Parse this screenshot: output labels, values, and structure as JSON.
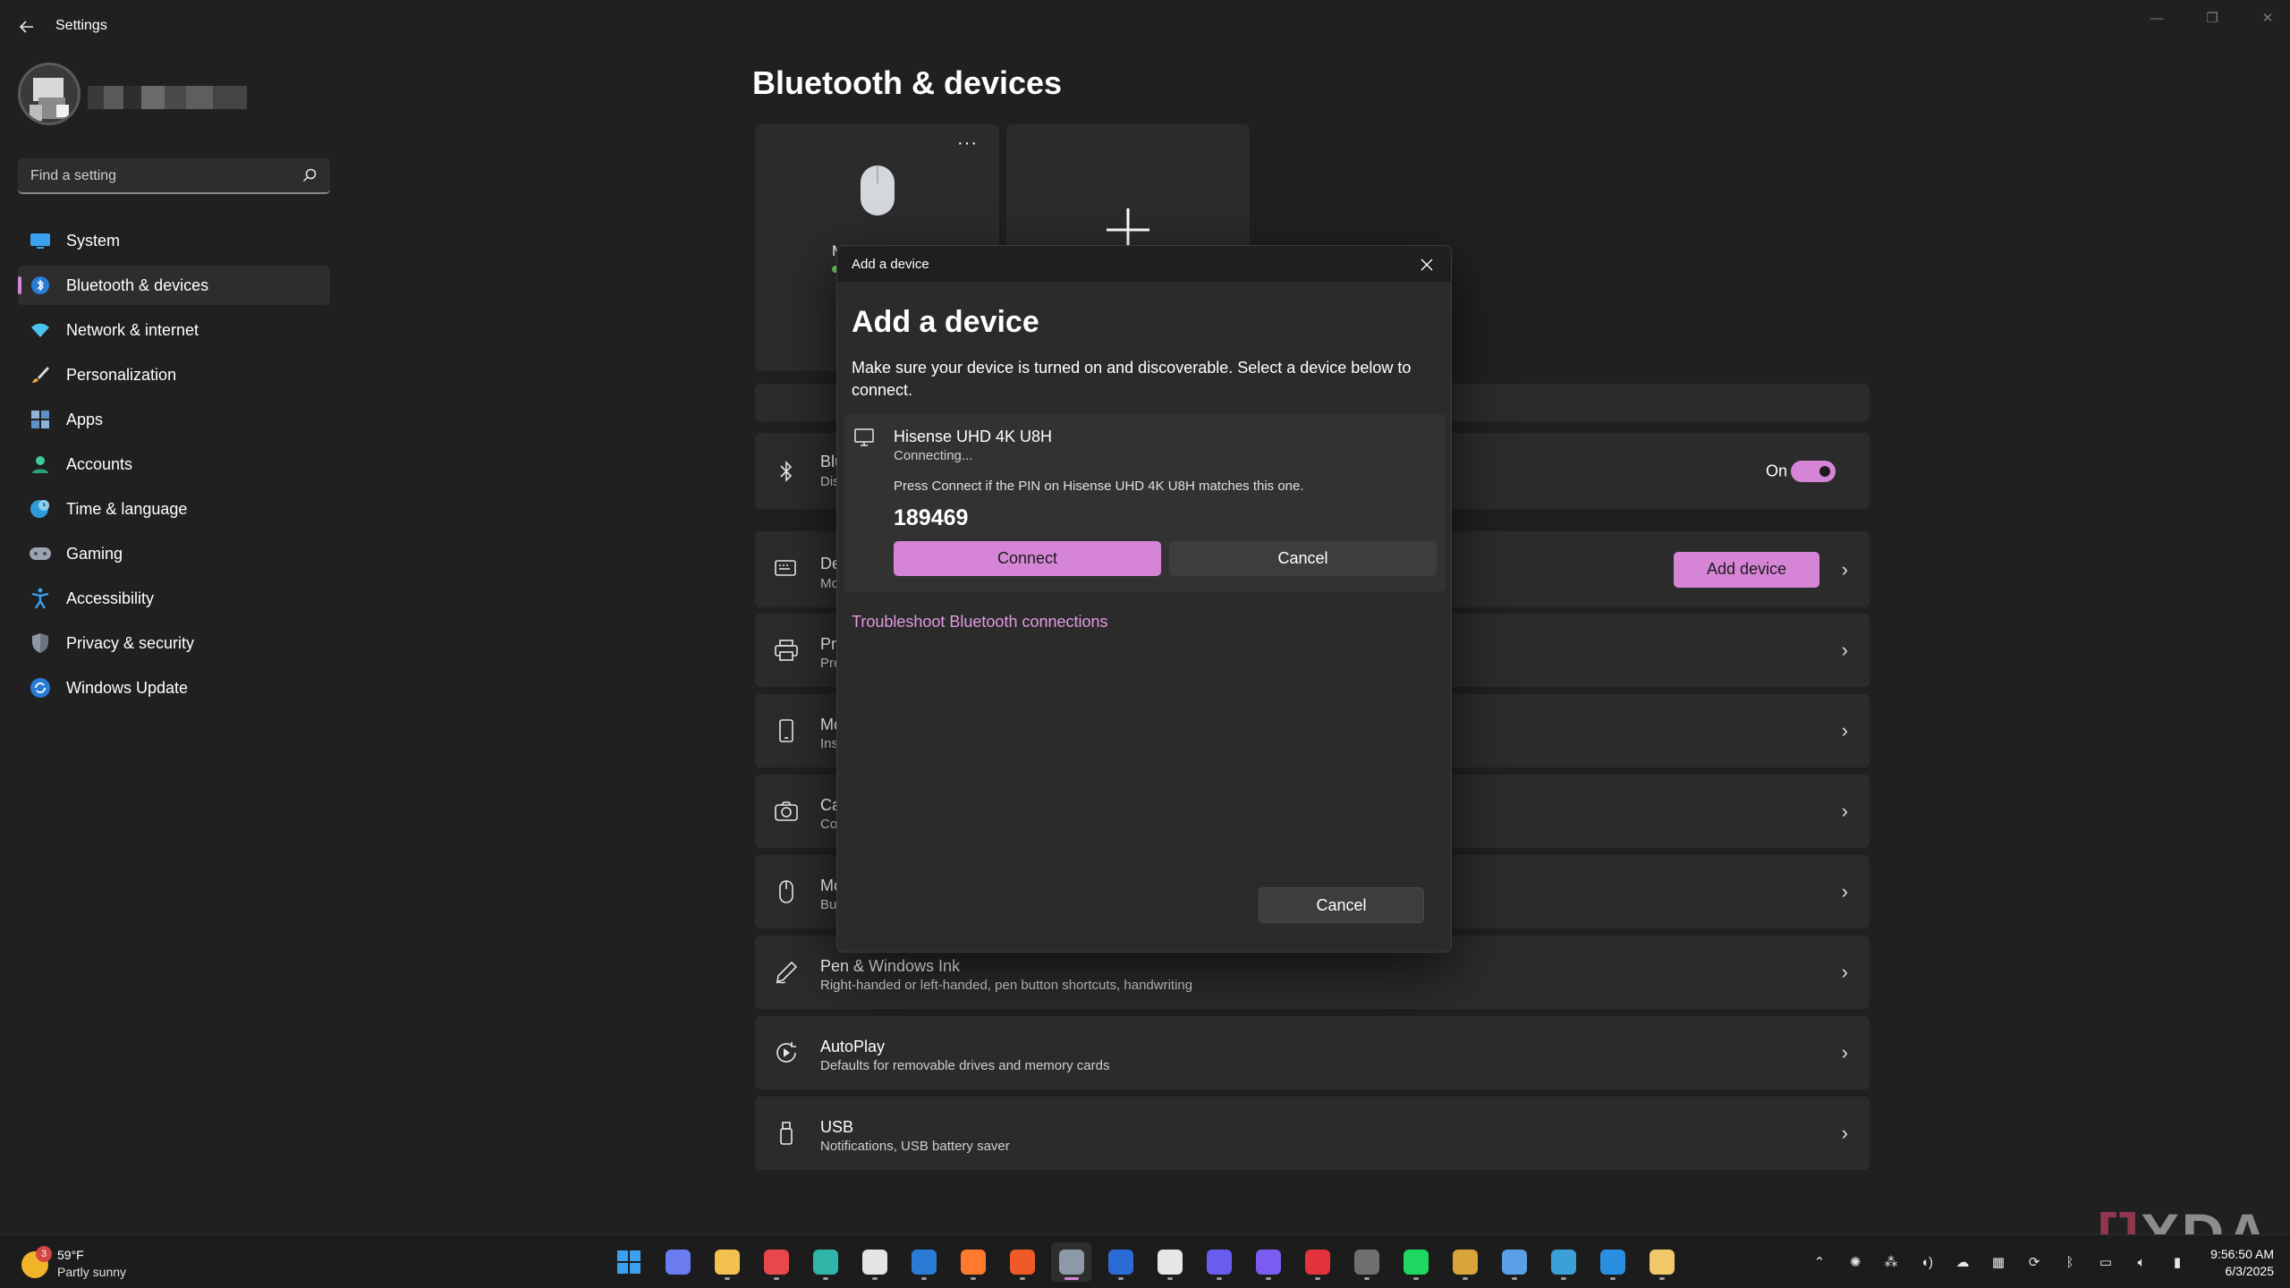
{
  "window": {
    "title": "Settings"
  },
  "colors": {
    "accent": "#d685d6",
    "link": "#e29ae2",
    "background": "#202020",
    "card": "#2b2b2b"
  },
  "sidebar": {
    "search_placeholder": "Find a setting",
    "items": [
      {
        "label": "System",
        "icon": "system-icon",
        "active": false
      },
      {
        "label": "Bluetooth & devices",
        "icon": "bluetooth-icon",
        "active": true
      },
      {
        "label": "Network & internet",
        "icon": "wifi-icon",
        "active": false
      },
      {
        "label": "Personalization",
        "icon": "brush-icon",
        "active": false
      },
      {
        "label": "Apps",
        "icon": "apps-icon",
        "active": false
      },
      {
        "label": "Accounts",
        "icon": "person-icon",
        "active": false
      },
      {
        "label": "Time & language",
        "icon": "globe-clock-icon",
        "active": false
      },
      {
        "label": "Gaming",
        "icon": "gamepad-icon",
        "active": false
      },
      {
        "label": "Accessibility",
        "icon": "accessibility-icon",
        "active": false
      },
      {
        "label": "Privacy & security",
        "icon": "shield-icon",
        "active": false
      },
      {
        "label": "Windows Update",
        "icon": "update-icon",
        "active": false
      }
    ]
  },
  "main": {
    "title": "Bluetooth & devices",
    "device_card": {
      "name_partial": "M",
      "more_label": "···"
    },
    "rows": [
      {
        "title": "Blu",
        "subtitle": "Dis",
        "icon": "bluetooth-icon",
        "toggle_label": "On"
      },
      {
        "title": "De",
        "subtitle": "Mo",
        "icon": "devices-icon",
        "button": "Add device"
      },
      {
        "title": "Pri",
        "subtitle": "Pre",
        "icon": "printer-icon"
      },
      {
        "title": "Mo",
        "subtitle": "Ins",
        "icon": "phone-icon"
      },
      {
        "title": "Ca",
        "subtitle": "Co",
        "icon": "camera-icon"
      },
      {
        "title": "Mo",
        "subtitle": "Bu",
        "icon": "mouse-icon"
      },
      {
        "title": "Pen & Windows Ink",
        "subtitle": "Right-handed or left-handed, pen button shortcuts, handwriting",
        "icon": "pen-icon"
      },
      {
        "title": "AutoPlay",
        "subtitle": "Defaults for removable drives and memory cards",
        "icon": "autoplay-icon"
      },
      {
        "title": "USB",
        "subtitle": "Notifications, USB battery saver",
        "icon": "usb-icon"
      }
    ]
  },
  "dialog": {
    "bar_title": "Add a device",
    "heading": "Add a device",
    "description": "Make sure your device is turned on and discoverable. Select a device below to connect.",
    "device": {
      "name": "Hisense UHD 4K U8H",
      "status": "Connecting...",
      "prompt": "Press Connect if the PIN on Hisense UHD 4K U8H matches this one.",
      "pin": "189469",
      "connect_label": "Connect",
      "cancel_label": "Cancel"
    },
    "troubleshoot_link": "Troubleshoot Bluetooth connections",
    "cancel_label": "Cancel"
  },
  "taskbar": {
    "weather": {
      "badge": "3",
      "temp": "59°F",
      "condition": "Partly sunny"
    },
    "apps": [
      {
        "name": "start-icon",
        "color": "#3aa0f0"
      },
      {
        "name": "copilot-icon",
        "color": "#6a7cf0"
      },
      {
        "name": "file-explorer-icon",
        "color": "#f2c14e"
      },
      {
        "name": "app-red-icon",
        "color": "#e8474b"
      },
      {
        "name": "edge-icon",
        "color": "#2fb5a7"
      },
      {
        "name": "store-icon",
        "color": "#e4e4e4"
      },
      {
        "name": "outlook-icon",
        "color": "#2a7bd6"
      },
      {
        "name": "firefox-icon",
        "color": "#ff7a2e"
      },
      {
        "name": "brave-icon",
        "color": "#f05a28"
      },
      {
        "name": "settings-icon",
        "color": "#8d99a6",
        "active": true
      },
      {
        "name": "word-icon",
        "color": "#2b6cd4"
      },
      {
        "name": "slack-icon",
        "color": "#e6e6e6"
      },
      {
        "name": "messenger-icon",
        "color": "#6b5cf0"
      },
      {
        "name": "mail-icon",
        "color": "#7a5cf0"
      },
      {
        "name": "vivaldi-icon",
        "color": "#e3343d"
      },
      {
        "name": "calculator-icon",
        "color": "#6f6f6f"
      },
      {
        "name": "spotify-icon",
        "color": "#1ed760"
      },
      {
        "name": "paint-icon",
        "color": "#d9a43a"
      },
      {
        "name": "notepad-icon",
        "color": "#5aa0e6"
      },
      {
        "name": "app-s-icon",
        "color": "#3aa0d6"
      },
      {
        "name": "vscode-icon",
        "color": "#2a8fe0"
      },
      {
        "name": "app-folder-icon",
        "color": "#f0c86a"
      }
    ],
    "clock": {
      "time": "9:56:50 AM",
      "date": "6/3/2025"
    }
  },
  "watermark": "XDA"
}
